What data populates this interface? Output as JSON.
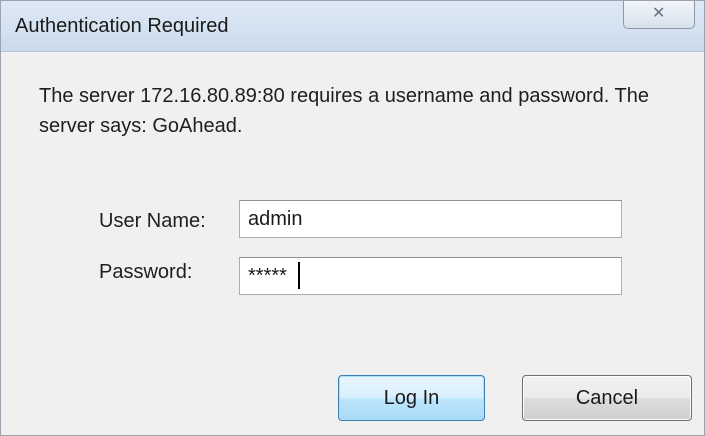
{
  "window": {
    "title": "Authentication Required",
    "close_glyph": "✕",
    "close_icon": "close-icon"
  },
  "message": "The server 172.16.80.89:80 requires a username and password. The server says: GoAhead.",
  "form": {
    "username_label": "User Name:",
    "username_value": "admin",
    "password_label": "Password:",
    "password_display": "*****"
  },
  "buttons": {
    "login_label": "Log In",
    "cancel_label": "Cancel"
  },
  "colors": {
    "titlebar": "#d3e1f1",
    "dialog_bg": "#f0f0f0",
    "default_button_border": "#3c7fb1"
  }
}
